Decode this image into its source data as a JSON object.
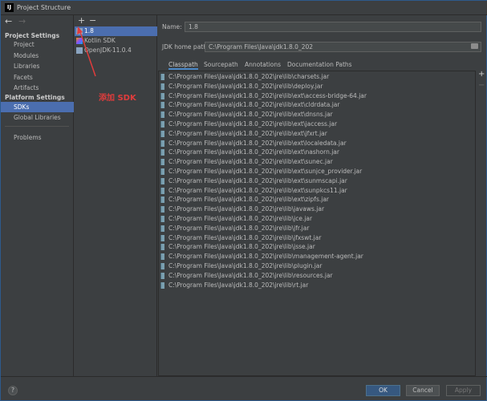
{
  "window": {
    "title": "Project Structure"
  },
  "sidebar": {
    "project_settings": "Project Settings",
    "project_items": [
      "Project",
      "Modules",
      "Libraries",
      "Facets",
      "Artifacts"
    ],
    "platform_settings": "Platform Settings",
    "platform_items": [
      "SDKs",
      "Global Libraries"
    ],
    "problems": "Problems",
    "selected": "SDKs"
  },
  "sdk_list": {
    "add": "+",
    "remove": "−",
    "items": [
      "1.8",
      "Kotlin SDK",
      "OpenJDK-11.0.4"
    ],
    "selected": "1.8"
  },
  "annotation": {
    "text": "添加 SDK",
    "color": "#e03c3c"
  },
  "form": {
    "name_label": "Name:",
    "name_value": "1.8",
    "home_label": "JDK home path:",
    "home_value": "C:\\Program Files\\Java\\jdk1.8.0_202"
  },
  "tabs": [
    "Classpath",
    "Sourcepath",
    "Annotations",
    "Documentation Paths"
  ],
  "active_tab": "Classpath",
  "classpath": [
    "C:\\Program Files\\Java\\jdk1.8.0_202\\jre\\lib\\charsets.jar",
    "C:\\Program Files\\Java\\jdk1.8.0_202\\jre\\lib\\deploy.jar",
    "C:\\Program Files\\Java\\jdk1.8.0_202\\jre\\lib\\ext\\access-bridge-64.jar",
    "C:\\Program Files\\Java\\jdk1.8.0_202\\jre\\lib\\ext\\cldrdata.jar",
    "C:\\Program Files\\Java\\jdk1.8.0_202\\jre\\lib\\ext\\dnsns.jar",
    "C:\\Program Files\\Java\\jdk1.8.0_202\\jre\\lib\\ext\\jaccess.jar",
    "C:\\Program Files\\Java\\jdk1.8.0_202\\jre\\lib\\ext\\jfxrt.jar",
    "C:\\Program Files\\Java\\jdk1.8.0_202\\jre\\lib\\ext\\localedata.jar",
    "C:\\Program Files\\Java\\jdk1.8.0_202\\jre\\lib\\ext\\nashorn.jar",
    "C:\\Program Files\\Java\\jdk1.8.0_202\\jre\\lib\\ext\\sunec.jar",
    "C:\\Program Files\\Java\\jdk1.8.0_202\\jre\\lib\\ext\\sunjce_provider.jar",
    "C:\\Program Files\\Java\\jdk1.8.0_202\\jre\\lib\\ext\\sunmscapi.jar",
    "C:\\Program Files\\Java\\jdk1.8.0_202\\jre\\lib\\ext\\sunpkcs11.jar",
    "C:\\Program Files\\Java\\jdk1.8.0_202\\jre\\lib\\ext\\zipfs.jar",
    "C:\\Program Files\\Java\\jdk1.8.0_202\\jre\\lib\\javaws.jar",
    "C:\\Program Files\\Java\\jdk1.8.0_202\\jre\\lib\\jce.jar",
    "C:\\Program Files\\Java\\jdk1.8.0_202\\jre\\lib\\jfr.jar",
    "C:\\Program Files\\Java\\jdk1.8.0_202\\jre\\lib\\jfxswt.jar",
    "C:\\Program Files\\Java\\jdk1.8.0_202\\jre\\lib\\jsse.jar",
    "C:\\Program Files\\Java\\jdk1.8.0_202\\jre\\lib\\management-agent.jar",
    "C:\\Program Files\\Java\\jdk1.8.0_202\\jre\\lib\\plugin.jar",
    "C:\\Program Files\\Java\\jdk1.8.0_202\\jre\\lib\\resources.jar",
    "C:\\Program Files\\Java\\jdk1.8.0_202\\jre\\lib\\rt.jar"
  ],
  "side_buttons": {
    "add": "+",
    "remove": "−"
  },
  "footer": {
    "help": "?",
    "ok": "OK",
    "cancel": "Cancel",
    "apply": "Apply"
  },
  "colors": {
    "accent": "#4b6eaf",
    "background": "#3c3f41",
    "ok_button": "#365880"
  }
}
